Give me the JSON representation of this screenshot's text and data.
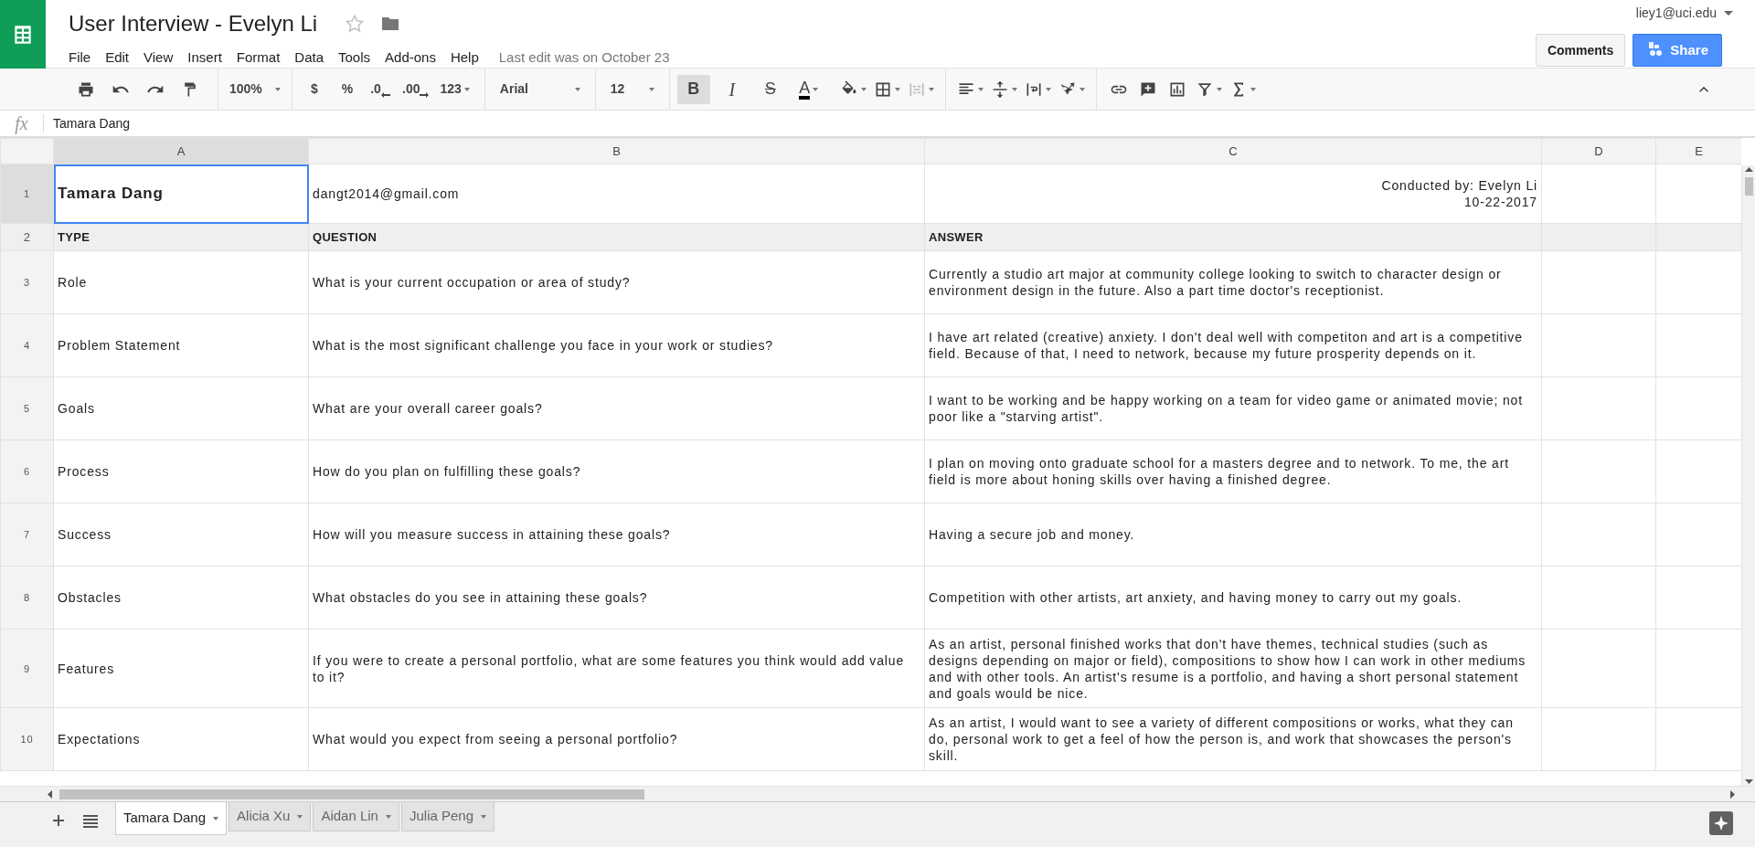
{
  "document": {
    "title": "User Interview - Evelyn Li",
    "last_edit": "Last edit was on October 23"
  },
  "menu": [
    "File",
    "Edit",
    "View",
    "Insert",
    "Format",
    "Data",
    "Tools",
    "Add-ons",
    "Help"
  ],
  "account": {
    "email": "liey1@uci.edu"
  },
  "buttons": {
    "comments": "Comments",
    "share": "Share"
  },
  "toolbar": {
    "zoom": "100%",
    "number_formats": [
      "$",
      "%",
      ".0",
      ".00",
      "123"
    ],
    "font": "Arial",
    "font_size": "12",
    "style_buttons": [
      {
        "label": "B",
        "selected": true
      },
      {
        "label": "I",
        "selected": false
      },
      {
        "label": "S",
        "selected": false
      },
      {
        "label": "A",
        "selected": false
      }
    ]
  },
  "formula_bar": {
    "label": "fx",
    "value": "Tamara Dang"
  },
  "columns": [
    {
      "label": "A",
      "selected": true
    },
    {
      "label": "B",
      "selected": false
    },
    {
      "label": "C",
      "selected": false
    },
    {
      "label": "D",
      "selected": false
    },
    {
      "label": "E",
      "selected": false
    }
  ],
  "rows": [
    {
      "number": "1",
      "kind": "title",
      "selected": true,
      "cells": [
        "Tamara Dang",
        "dangt2014@gmail.com",
        "Conducted by: Evelyn Li\n10-22-2017"
      ]
    },
    {
      "number": "2",
      "kind": "header",
      "selected": false,
      "cells": [
        "TYPE",
        "QUESTION",
        "ANSWER"
      ]
    },
    {
      "number": "3",
      "kind": "data",
      "selected": false,
      "cells": [
        "Role",
        "What is your current occupation or area of study?",
        "Currently a studio art major at community college looking to switch to character design or environment design in the future. Also a part time doctor's receptionist."
      ]
    },
    {
      "number": "4",
      "kind": "data",
      "selected": false,
      "cells": [
        "Problem Statement",
        "What is the most significant challenge you face in your work or studies?",
        "I have art related (creative) anxiety. I don't deal well with competiton and art is a competitive field. Because of that, I need to network, because my future prosperity depends on it."
      ]
    },
    {
      "number": "5",
      "kind": "data",
      "selected": false,
      "cells": [
        "Goals",
        "What are your overall career goals?",
        "I want to be working and be happy working on a team for video game or animated movie; not poor like a \"starving artist\"."
      ]
    },
    {
      "number": "6",
      "kind": "data",
      "selected": false,
      "cells": [
        "Process",
        "How do you plan on fulfilling these goals?",
        "I plan on moving onto graduate school for a masters degree and to network. To me, the art field is more about honing skills over having a finished degree."
      ]
    },
    {
      "number": "7",
      "kind": "data",
      "selected": false,
      "cells": [
        "Success",
        "How will you measure success in attaining these goals?",
        "Having a secure job and money."
      ]
    },
    {
      "number": "8",
      "kind": "data",
      "selected": false,
      "cells": [
        "Obstacles",
        "What obstacles do you see in attaining these goals?",
        "Competition with other artists, art anxiety, and having money to carry out my goals."
      ]
    },
    {
      "number": "9",
      "kind": "data",
      "selected": false,
      "cells": [
        "Features",
        "If you were to create a personal portfolio, what are some features you think would add value to it?",
        "As an artist, personal finished works that don't have themes, technical studies (such as designs depending on major or field), compositions to show how I can work in other mediums and with other tools. An artist's resume is a portfolio, and having a short personal statement and goals would be nice."
      ]
    },
    {
      "number": "10",
      "kind": "data",
      "selected": false,
      "cells": [
        "Expectations",
        "What would you expect from seeing a personal portfolio?",
        "As an artist, I would want to see a variety of different compositions or works, what they can do, personal work to get a feel of how the person is, and work that showcases the person's skill."
      ]
    }
  ],
  "sheets": [
    {
      "label": "Tamara Dang",
      "selected": true
    },
    {
      "label": "Alicia Xu",
      "selected": false
    },
    {
      "label": "Aidan Lin",
      "selected": false
    },
    {
      "label": "Julia Peng",
      "selected": false
    }
  ]
}
